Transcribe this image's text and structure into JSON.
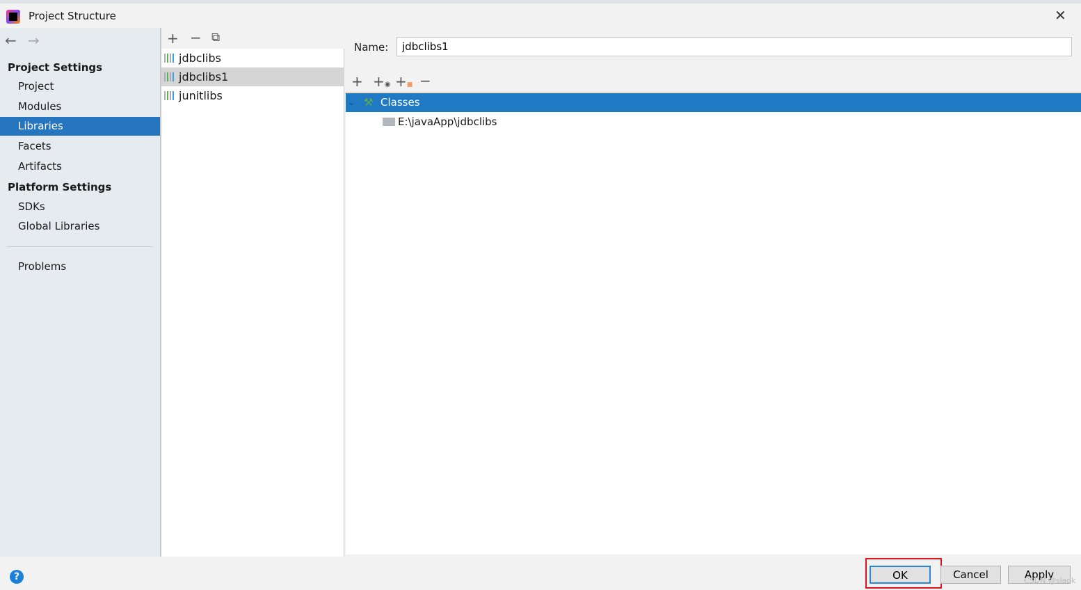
{
  "window": {
    "title": "Project Structure",
    "close_icon": "close-icon"
  },
  "sidebar": {
    "project_settings": "Project Settings",
    "project_items": [
      {
        "label": "Project"
      },
      {
        "label": "Modules"
      },
      {
        "label": "Libraries",
        "selected": true
      },
      {
        "label": "Facets"
      },
      {
        "label": "Artifacts"
      }
    ],
    "platform_settings": "Platform Settings",
    "platform_items": [
      {
        "label": "SDKs"
      },
      {
        "label": "Global Libraries"
      }
    ],
    "problems": "Problems"
  },
  "libraries": [
    {
      "name": "jdbclibs"
    },
    {
      "name": "jdbclibs1",
      "selected": true
    },
    {
      "name": "junitlibs"
    }
  ],
  "detail": {
    "name_label": "Name:",
    "name_value": "jdbclibs1",
    "root": "Classes",
    "path": "E:\\javaApp\\jdbclibs"
  },
  "footer": {
    "ok": "OK",
    "cancel": "Cancel",
    "apply": "Apply",
    "watermark": "CSDN @slaok"
  },
  "colors": {
    "selection": "#2675bf",
    "highlight": "#e0141e"
  }
}
